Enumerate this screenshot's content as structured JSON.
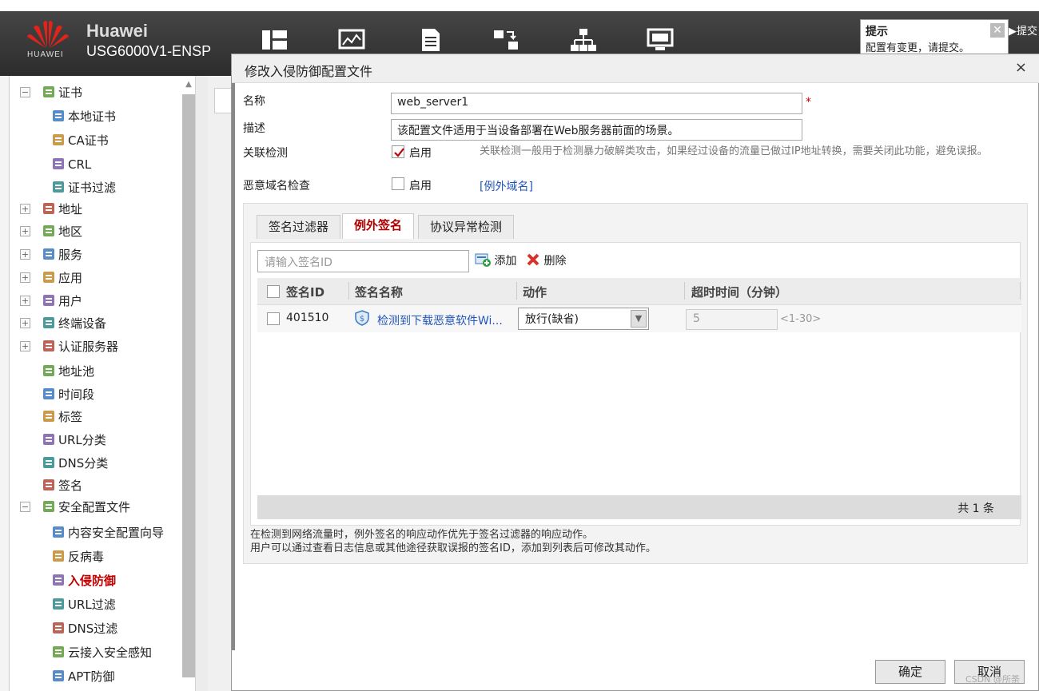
{
  "header": {
    "brand_name": "Huawei",
    "brand_model": "USG6000V1-ENSP",
    "brand_small": "HUAWEI",
    "submit_label": "▶提交",
    "icons": [
      "dashboard-icon",
      "monitor-chart-icon",
      "document-icon",
      "policy-icon",
      "network-icon",
      "system-icon"
    ]
  },
  "tooltip": {
    "title": "提示",
    "message": "配置有变更，请提交。",
    "close": "✕"
  },
  "sidebar": {
    "items": [
      {
        "label": "证书",
        "toggle": "−"
      },
      {
        "label": "本地证书"
      },
      {
        "label": "CA证书"
      },
      {
        "label": "CRL"
      },
      {
        "label": "证书过滤"
      },
      {
        "label": "地址",
        "toggle": "+"
      },
      {
        "label": "地区",
        "toggle": "+"
      },
      {
        "label": "服务",
        "toggle": "+"
      },
      {
        "label": "应用",
        "toggle": "+"
      },
      {
        "label": "用户",
        "toggle": "+"
      },
      {
        "label": "终端设备",
        "toggle": "+"
      },
      {
        "label": "认证服务器",
        "toggle": "+"
      },
      {
        "label": "地址池"
      },
      {
        "label": "时间段"
      },
      {
        "label": "标签"
      },
      {
        "label": "URL分类"
      },
      {
        "label": "DNS分类"
      },
      {
        "label": "签名"
      },
      {
        "label": "安全配置文件",
        "toggle": "−"
      },
      {
        "label": "内容安全配置向导"
      },
      {
        "label": "反病毒"
      },
      {
        "label": "入侵防御"
      },
      {
        "label": "URL过滤"
      },
      {
        "label": "DNS过滤"
      },
      {
        "label": "云接入安全感知"
      },
      {
        "label": "APT防御"
      }
    ],
    "selected": "入侵防御"
  },
  "modal": {
    "title": "修改入侵防御配置文件",
    "close": "×",
    "fields": {
      "name_label": "名称",
      "name_value": "web_server1",
      "required_mark": "*",
      "desc_label": "描述",
      "desc_value": "该配置文件适用于当设备部署在Web服务器前面的场景。",
      "correlation_label": "关联检测",
      "correlation_enable": "启用",
      "correlation_checked": true,
      "correlation_hint": "关联检测一般用于检测暴力破解类攻击，如果经过设备的流量已做过IP地址转换，需要关闭此功能，避免误报。",
      "malicious_label": "恶意域名检查",
      "malicious_enable": "启用",
      "malicious_checked": false,
      "exception_domain_link": "[例外域名]"
    },
    "tabs": [
      {
        "label": "签名过滤器",
        "active": false
      },
      {
        "label": "例外签名",
        "active": true
      },
      {
        "label": "协议异常检测",
        "active": false
      }
    ],
    "toolbar": {
      "search_placeholder": "请输入签名ID",
      "add_label": "添加",
      "delete_label": "删除"
    },
    "table": {
      "columns": [
        "签名ID",
        "签名名称",
        "动作",
        "超时时间（分钟）"
      ],
      "rows": [
        {
          "id": "401510",
          "name": "检测到下载恶意软件Wi...",
          "action": "放行(缺省)",
          "timeout": "5",
          "range": "<1-30>"
        }
      ],
      "total": "共 1 条"
    },
    "note_line1": "在检测到网络流量时，例外签名的响应动作优先于签名过滤器的响应动作。",
    "note_line2": "用户可以通过查看日志信息或其他途径获取误报的签名ID，添加到列表后可修改其动作。",
    "ok_label": "确定",
    "cancel_label": "取消"
  },
  "watermark": "CSDN @所荼",
  "colors": {
    "accent_red": "#c00000",
    "link_blue": "#2255bb",
    "topbar": "#333333"
  }
}
